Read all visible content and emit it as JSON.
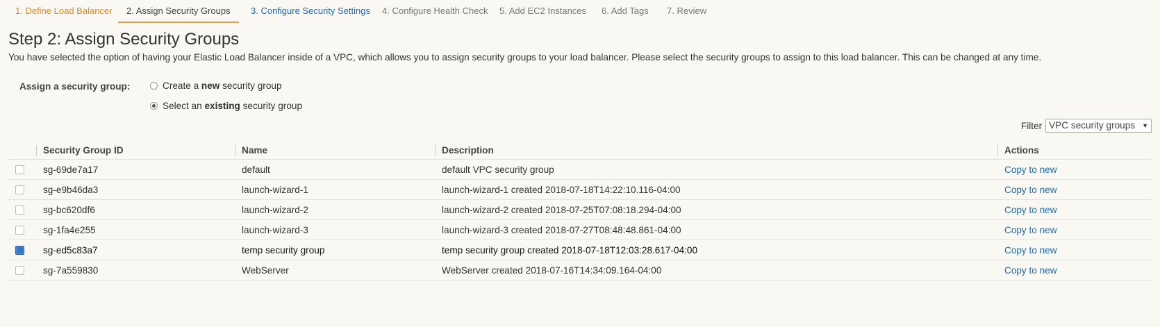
{
  "wizard": {
    "tabs": [
      {
        "label": "1. Define Load Balancer"
      },
      {
        "label": "2. Assign Security Groups"
      },
      {
        "label": "3. Configure Security Settings"
      },
      {
        "label": "4. Configure Health Check"
      },
      {
        "label": "5. Add EC2 Instances"
      },
      {
        "label": "6. Add Tags"
      },
      {
        "label": "7. Review"
      }
    ]
  },
  "step": {
    "title": "Step 2: Assign Security Groups",
    "description": "You have selected the option of having your Elastic Load Balancer inside of a VPC, which allows you to assign security groups to your load balancer. Please select the security groups to assign to this load balancer. This can be changed at any time."
  },
  "assign": {
    "label": "Assign a security group:",
    "option_new": {
      "pre": "Create a ",
      "bold": "new",
      "post": " security group",
      "selected": false
    },
    "option_existing": {
      "pre": "Select an ",
      "bold": "existing",
      "post": " security group",
      "selected": true
    }
  },
  "filter": {
    "label": "Filter",
    "value": "VPC security groups"
  },
  "table": {
    "headers": {
      "id": "Security Group ID",
      "name": "Name",
      "description": "Description",
      "actions": "Actions"
    },
    "rows": [
      {
        "id": "sg-69de7a17",
        "name": "default",
        "description": "default VPC security group",
        "action": "Copy to new",
        "checked": false
      },
      {
        "id": "sg-e9b46da3",
        "name": "launch-wizard-1",
        "description": "launch-wizard-1 created 2018-07-18T14:22:10.116-04:00",
        "action": "Copy to new",
        "checked": false
      },
      {
        "id": "sg-bc620df6",
        "name": "launch-wizard-2",
        "description": "launch-wizard-2 created 2018-07-25T07:08:18.294-04:00",
        "action": "Copy to new",
        "checked": false
      },
      {
        "id": "sg-1fa4e255",
        "name": "launch-wizard-3",
        "description": "launch-wizard-3 created 2018-07-27T08:48:48.861-04:00",
        "action": "Copy to new",
        "checked": false
      },
      {
        "id": "sg-ed5c83a7",
        "name": "temp security group",
        "description": "temp security group created 2018-07-18T12:03:28.617-04:00",
        "action": "Copy to new",
        "checked": true
      },
      {
        "id": "sg-7a559830",
        "name": "WebServer",
        "description": "WebServer created 2018-07-16T14:34:09.164-04:00",
        "action": "Copy to new",
        "checked": false
      }
    ]
  }
}
